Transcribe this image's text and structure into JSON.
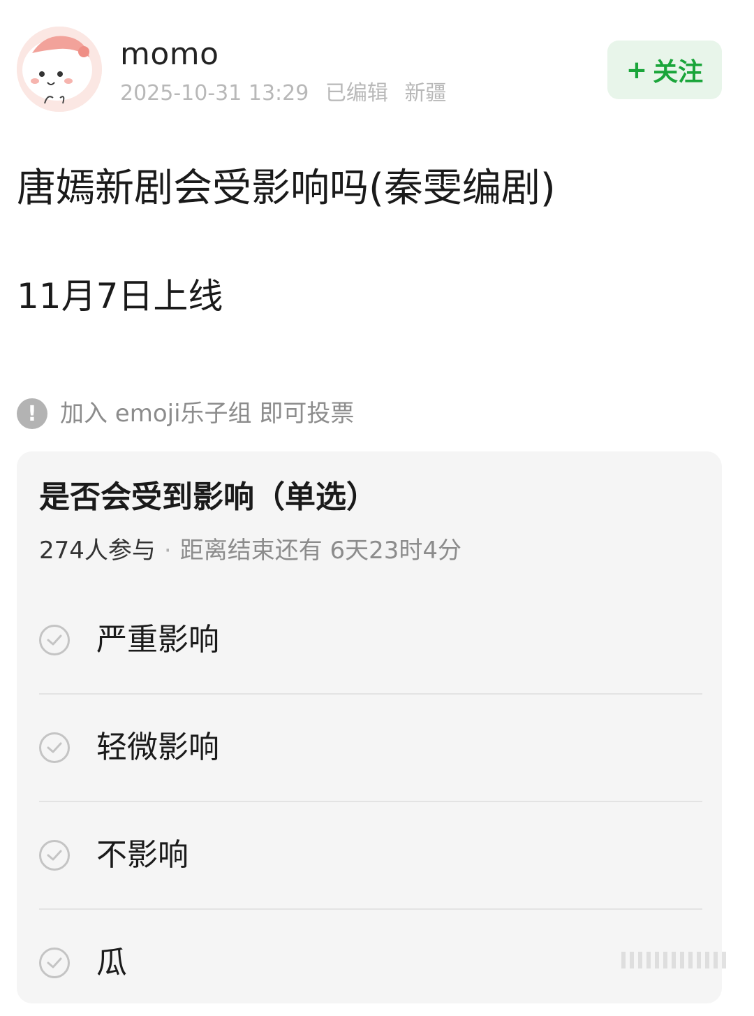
{
  "header": {
    "username": "momo",
    "timestamp": "2025-10-31 13:29",
    "edited": "已编辑",
    "location": "新疆",
    "follow_label": "关注",
    "follow_plus": "+",
    "follow_color": "#1aa53a"
  },
  "post": {
    "title": "唐嫣新剧会受影响吗(秦雯编剧)",
    "body": "11月7日上线"
  },
  "notice": {
    "icon": "!",
    "text": "加入 emoji乐子组 即可投票"
  },
  "poll": {
    "title": "是否会受到影响（单选）",
    "participants": "274人参与",
    "separator": "·",
    "remaining": "距离结束还有 6天23时4分",
    "options": [
      {
        "label": "严重影响"
      },
      {
        "label": "轻微影响"
      },
      {
        "label": "不影响"
      },
      {
        "label": "瓜"
      }
    ]
  }
}
